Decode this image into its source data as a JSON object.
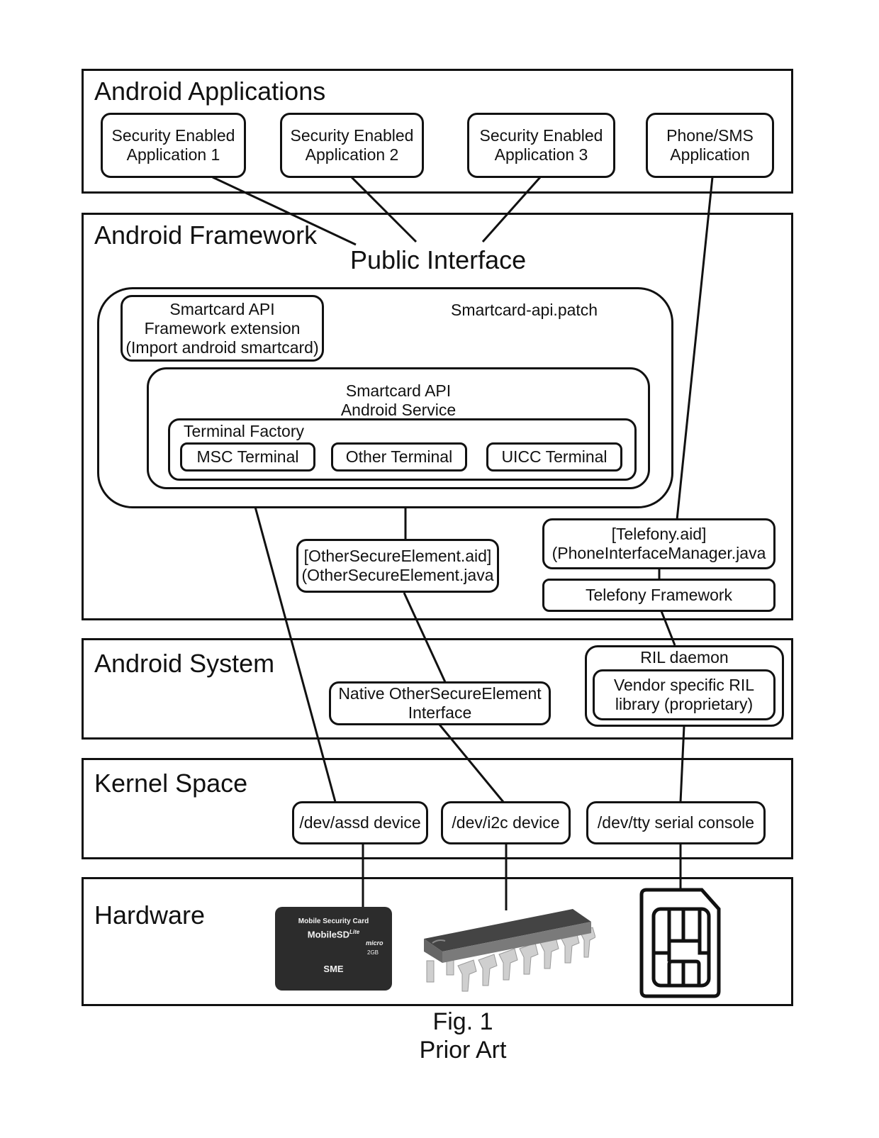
{
  "layers": {
    "applications": "Android Applications",
    "framework": "Android Framework",
    "system": "Android System",
    "kernel": "Kernel Space",
    "hardware": "Hardware"
  },
  "applications": [
    "Security Enabled\nApplication 1",
    "Security Enabled\nApplication 2",
    "Security Enabled\nApplication 3",
    "Phone/SMS\nApplication"
  ],
  "framework": {
    "public_interface": "Public Interface",
    "patch_label": "Smartcard-api.patch",
    "api_extension": "Smartcard API\nFramework extension\n(Import android smartcard)",
    "api_service": "Smartcard API\nAndroid Service",
    "terminal_factory": "Terminal Factory",
    "terminals": [
      "MSC Terminal",
      "Other Terminal",
      "UICC Terminal"
    ],
    "other_secure_element": "[OtherSecureElement.aid]\n(OtherSecureElement.java",
    "telefony_aid": "[Telefony.aid]\n(PhoneInterfaceManager.java",
    "telefony_framework": "Telefony Framework"
  },
  "system": {
    "native_interface": "Native OtherSecureElement\nInterface",
    "ril_daemon": "RIL daemon",
    "vendor_ril": "Vendor specific RIL\nlibrary (proprietary)"
  },
  "kernel": {
    "devices": [
      "/dev/assd device",
      "/dev/i2c device",
      "/dev/tty serial console"
    ]
  },
  "hardware": {
    "sd_card": {
      "line1": "Mobile Security Card",
      "line2": "MobileSD",
      "sup": "Lite",
      "micro": "micro",
      "capacity": "2GB",
      "brand": "SME"
    },
    "items": [
      "microSD security card",
      "integrated circuit chip",
      "SIM card"
    ]
  },
  "caption": {
    "figure": "Fig. 1",
    "subtitle": "Prior Art"
  }
}
